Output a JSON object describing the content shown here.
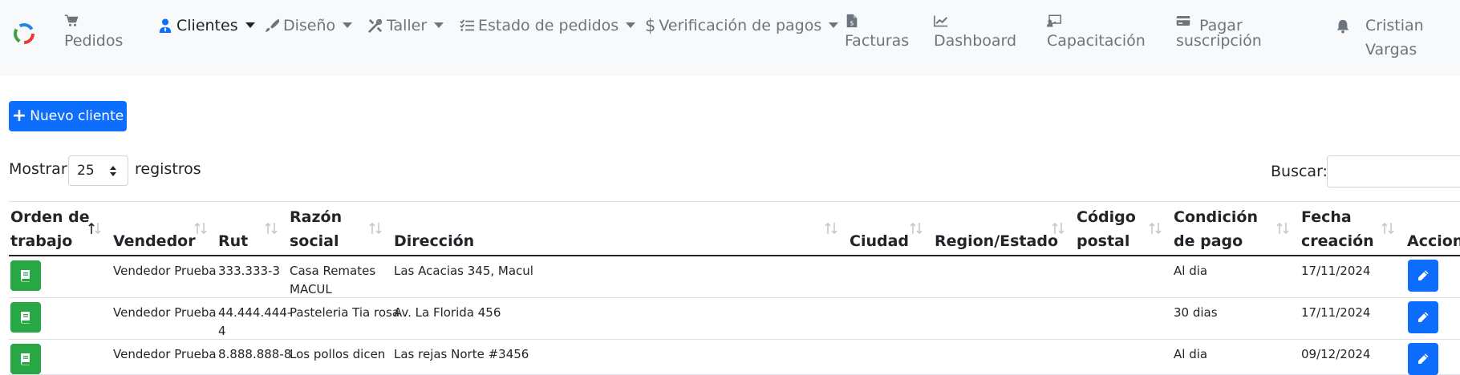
{
  "nav": {
    "pedidos": "Pedidos",
    "clientes": "Clientes",
    "diseno": "Diseño",
    "taller": "Taller",
    "estado_pedidos": "Estado de pedidos",
    "verificacion_pagos": "Verificación de pagos",
    "facturas": "Facturas",
    "dashboard": "Dashboard",
    "capacitacion": "Capacitación",
    "pagar_line1": "Pagar",
    "pagar_line2": "suscripción",
    "user_line1": "Cristian",
    "user_line2": "Vargas"
  },
  "toolbar": {
    "new_client_label": "Nuevo cliente"
  },
  "length_menu": {
    "prefix": "Mostrar",
    "value": "25",
    "suffix": "registros"
  },
  "search": {
    "label": "Buscar:"
  },
  "table": {
    "headers": {
      "orden_line1": "Orden de",
      "orden_line2": "trabajo",
      "vendedor": "Vendedor",
      "rut": "Rut",
      "razon_line1": "Razón",
      "razon_line2": "social",
      "direccion": "Dirección",
      "ciudad": "Ciudad",
      "region": "Region/Estado",
      "codigo_line1": "Código",
      "codigo_line2": "postal",
      "condicion_line1": "Condición",
      "condicion_line2": "de pago",
      "fecha_line1": "Fecha",
      "fecha_line2": "creación",
      "acciones": "Acciones"
    },
    "rows": [
      {
        "vendedor": "Vendedor Prueba",
        "rut_line1": "333.333-3",
        "rut_line2": "",
        "razon_line1": "Casa Remates",
        "razon_line2": "MACUL",
        "direccion": "Las Acacias 345, Macul",
        "condicion": "Al dia",
        "fecha": "17/11/2024"
      },
      {
        "vendedor": "Vendedor Prueba",
        "rut_line1": "44.444.444-",
        "rut_line2": "4",
        "razon_line1": "Pasteleria Tia rosa",
        "razon_line2": "",
        "direccion": "Av. La Florida 456",
        "condicion": "30 dias",
        "fecha": "17/11/2024"
      },
      {
        "vendedor": "Vendedor Prueba",
        "rut_line1": "8.888.888-8",
        "rut_line2": "",
        "razon_line1": "Los pollos dicen",
        "razon_line2": "",
        "direccion": "Las rejas Norte #3456",
        "condicion": "Al dia",
        "fecha": "09/12/2024"
      }
    ]
  },
  "colors": {
    "primary": "#0d6efd",
    "success": "#28a745",
    "navbar_bg": "#f8f9fa",
    "muted": "#6c757d"
  }
}
